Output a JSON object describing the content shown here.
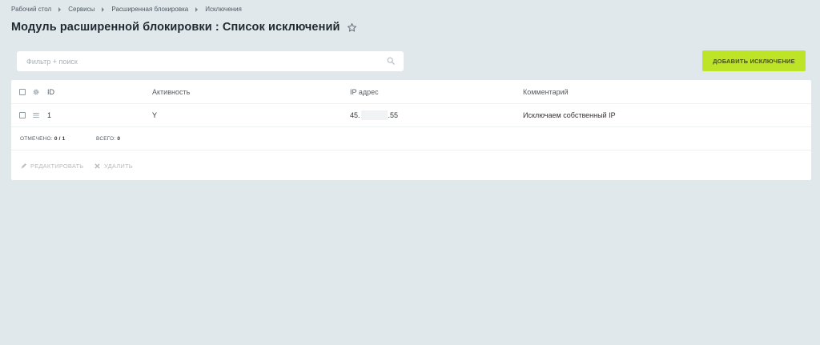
{
  "breadcrumbs": [
    "Рабочий стол",
    "Сервисы",
    "Расширенная блокировка",
    "Исключения"
  ],
  "page_title": "Модуль расширенной блокировки : Список исключений",
  "filter": {
    "placeholder": "Фильтр + поиск"
  },
  "add_button_label": "ДОБАВИТЬ ИСКЛЮЧЕНИЕ",
  "table": {
    "columns": {
      "id": "ID",
      "active": "Активность",
      "ip": "IP адрес",
      "comment": "Комментарий"
    },
    "rows": [
      {
        "id": "1",
        "active": "Y",
        "ip_start": "45.",
        "ip_end": ".55",
        "comment": "Исключаем собственный IP"
      }
    ]
  },
  "footer": {
    "selected_label": "ОТМЕЧЕНО:",
    "selected_value": "0 / 1",
    "total_label": "ВСЕГО:",
    "total_value": "0"
  },
  "actions": {
    "edit": "РЕДАКТИРОВАТЬ",
    "delete": "УДАЛИТЬ"
  },
  "colors": {
    "accent": "#bde427",
    "background": "#e1e8ec"
  }
}
